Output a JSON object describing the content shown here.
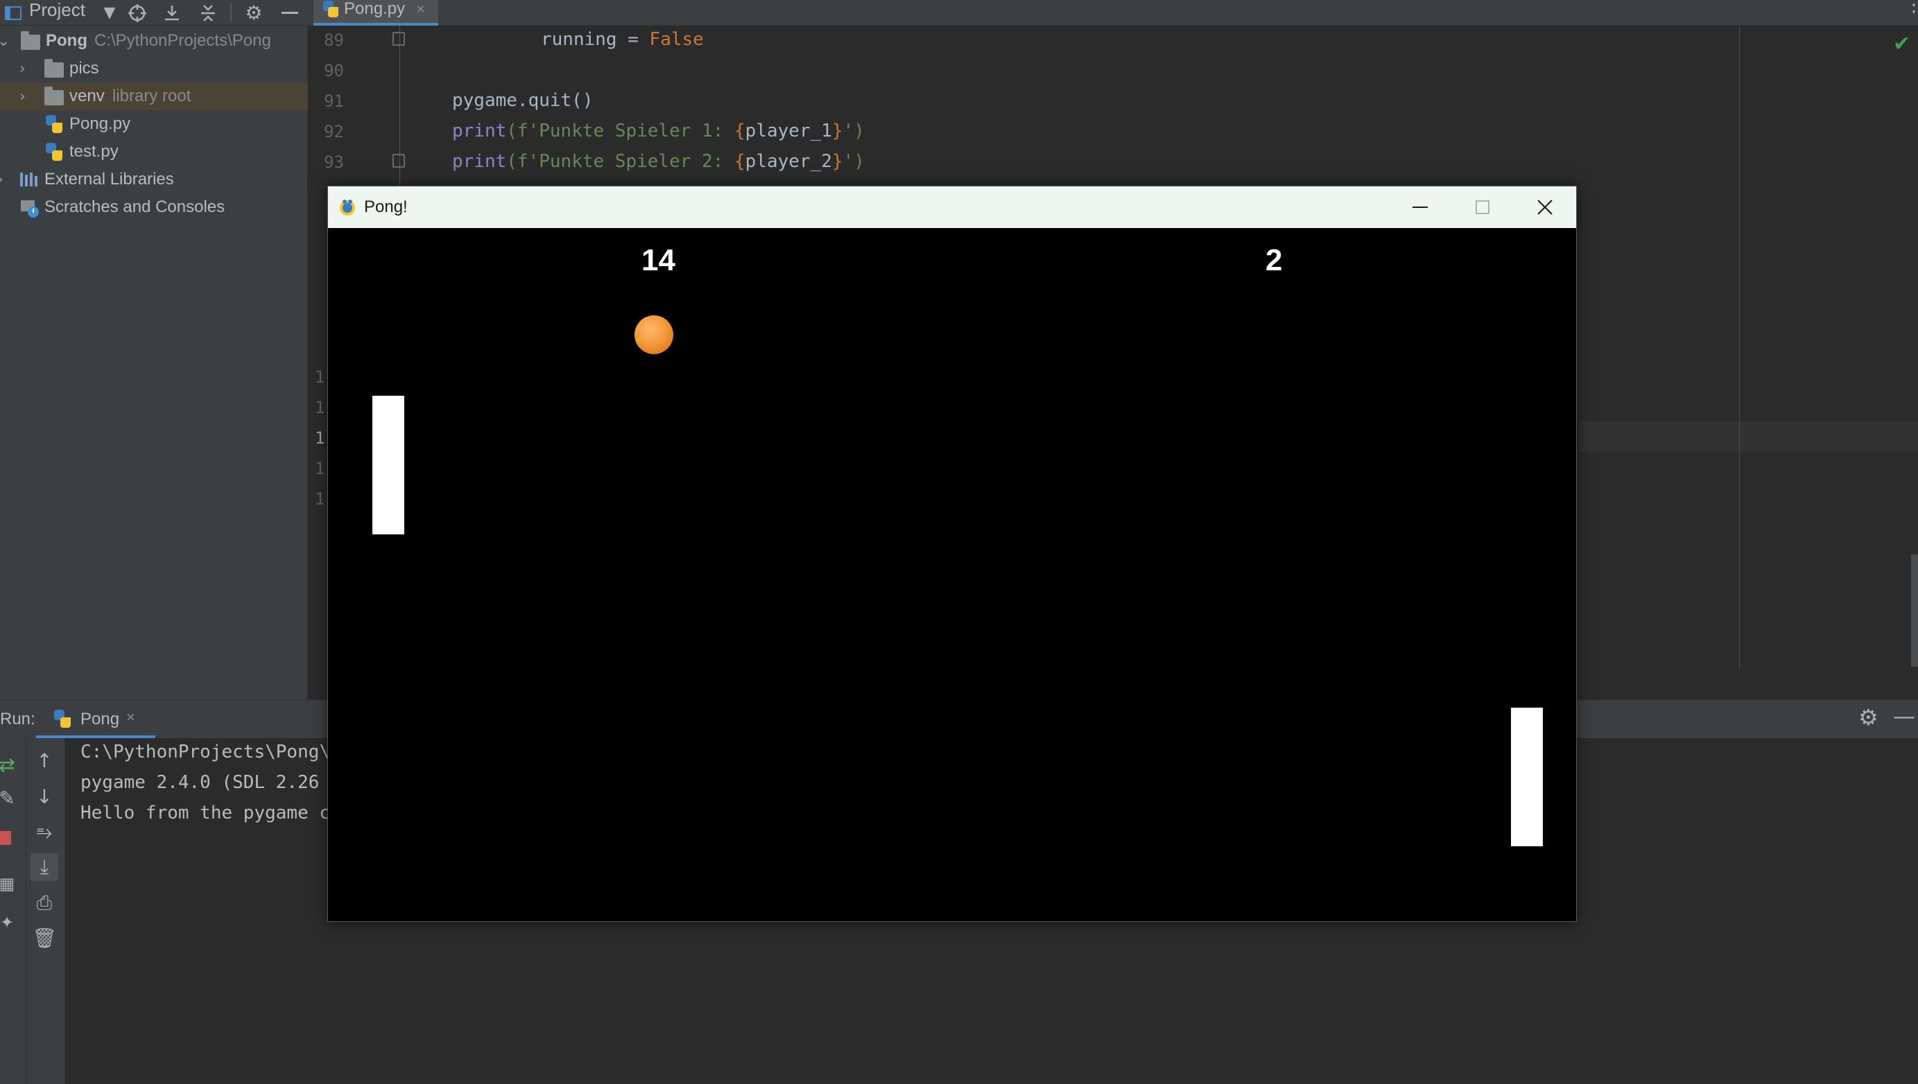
{
  "topbar": {
    "project_title": "Project",
    "editor_tab_label": "Pong.py",
    "editor_tab_close": "×"
  },
  "tree": {
    "items": [
      {
        "label": "Pong",
        "hint": "C:\\PythonProjects\\Pong",
        "type": "folder",
        "expanded": true
      },
      {
        "label": "pics",
        "type": "folder"
      },
      {
        "label": "venv",
        "hint": "library root",
        "type": "folder",
        "selected": true
      },
      {
        "label": "Pong.py",
        "type": "python-file"
      },
      {
        "label": "test.py",
        "type": "python-file"
      },
      {
        "label": "External Libraries",
        "type": "library"
      },
      {
        "label": "Scratches and Consoles",
        "type": "scratches"
      }
    ]
  },
  "editor": {
    "line_numbers": [
      "89",
      "90",
      "91",
      "92",
      "93"
    ],
    "partial_line_numbers": [
      "1",
      "1",
      "1",
      "1",
      "1"
    ],
    "code": {
      "line89_a": "running = ",
      "line89_b": "False",
      "line91": "pygame.quit()",
      "line92_fn": "print",
      "line92_str_a": "(f'Punkte Spieler 1: ",
      "line92_var": "player_1",
      "line92_str_b": "')",
      "line93_fn": "print",
      "line93_str_a": "(f'Punkte Spieler 2: ",
      "line93_var": "player_2",
      "line93_str_b": "')"
    }
  },
  "run": {
    "label": "Run:",
    "tab_label": "Pong",
    "tab_close": "×",
    "console_lines": [
      "C:\\PythonProjects\\Pong\\",
      "pygame 2.4.0 (SDL 2.26",
      "Hello from the pygame c"
    ]
  },
  "pong_window": {
    "title": "Pong!",
    "score_player_1": "14",
    "score_player_2": "2",
    "colors": {
      "ball": "#f59a3c",
      "paddle": "#ffffff",
      "background": "#000000",
      "titlebar": "#eef6ef"
    }
  },
  "icons": {
    "project_dropdown": "chevron-down-icon",
    "locate": "crosshair-icon",
    "expand_all": "expand-all-icon",
    "collapse_all": "collapse-all-icon",
    "settings": "gear-icon",
    "hide": "minimize-icon",
    "inspection_ok": "checkmark-icon"
  },
  "accent_color": "#4a88c7"
}
